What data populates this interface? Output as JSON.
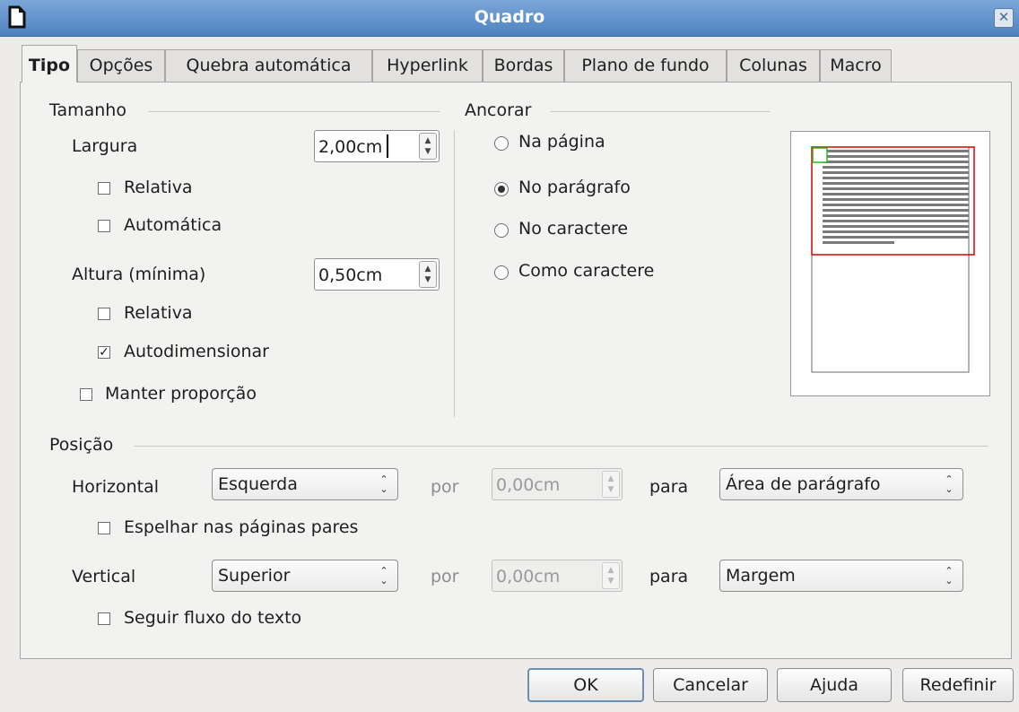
{
  "window": {
    "title": "Quadro"
  },
  "tabs": [
    "Tipo",
    "Opções",
    "Quebra automática",
    "Hyperlink",
    "Bordas",
    "Plano de fundo",
    "Colunas",
    "Macro"
  ],
  "tamanho": {
    "header": "Tamanho",
    "largura_label": "Largura",
    "largura_value": "2,00cm",
    "relativa1": "Relativa",
    "automatica": "Automática",
    "altura_label": "Altura (mínima)",
    "altura_value": "0,50cm",
    "relativa2": "Relativa",
    "autodimensionar": "Autodimensionar",
    "manter_proporcao": "Manter proporção"
  },
  "ancorar": {
    "header": "Ancorar",
    "options": [
      "Na página",
      "No parágrafo",
      "No caractere",
      "Como caractere"
    ],
    "selected": "No parágrafo"
  },
  "posicao": {
    "header": "Posição",
    "horizontal_label": "Horizontal",
    "horizontal_value": "Esquerda",
    "por1": "por",
    "h_offset": "0,00cm",
    "para1": "para",
    "h_para_value": "Área de parágrafo",
    "espelhar": "Espelhar nas páginas pares",
    "vertical_label": "Vertical",
    "vertical_value": "Superior",
    "por2": "por",
    "v_offset": "0,00cm",
    "para2": "para",
    "v_para_value": "Margem",
    "seguir_fluxo": "Seguir fluxo do texto"
  },
  "checks": {
    "relativa1": false,
    "automatica": false,
    "relativa2": false,
    "autodimensionar": true,
    "manter_proporcao": false,
    "espelhar": false,
    "seguir_fluxo": false
  },
  "buttons": {
    "ok": "OK",
    "cancel": "Cancelar",
    "help": "Ajuda",
    "reset": "Redefinir"
  },
  "icons": {
    "app": "document-icon",
    "close": "close-icon"
  },
  "colors": {
    "titlebar": "#5b8cc8",
    "frame_outline": "#e00000",
    "anchor_marker": "#22bb22"
  }
}
